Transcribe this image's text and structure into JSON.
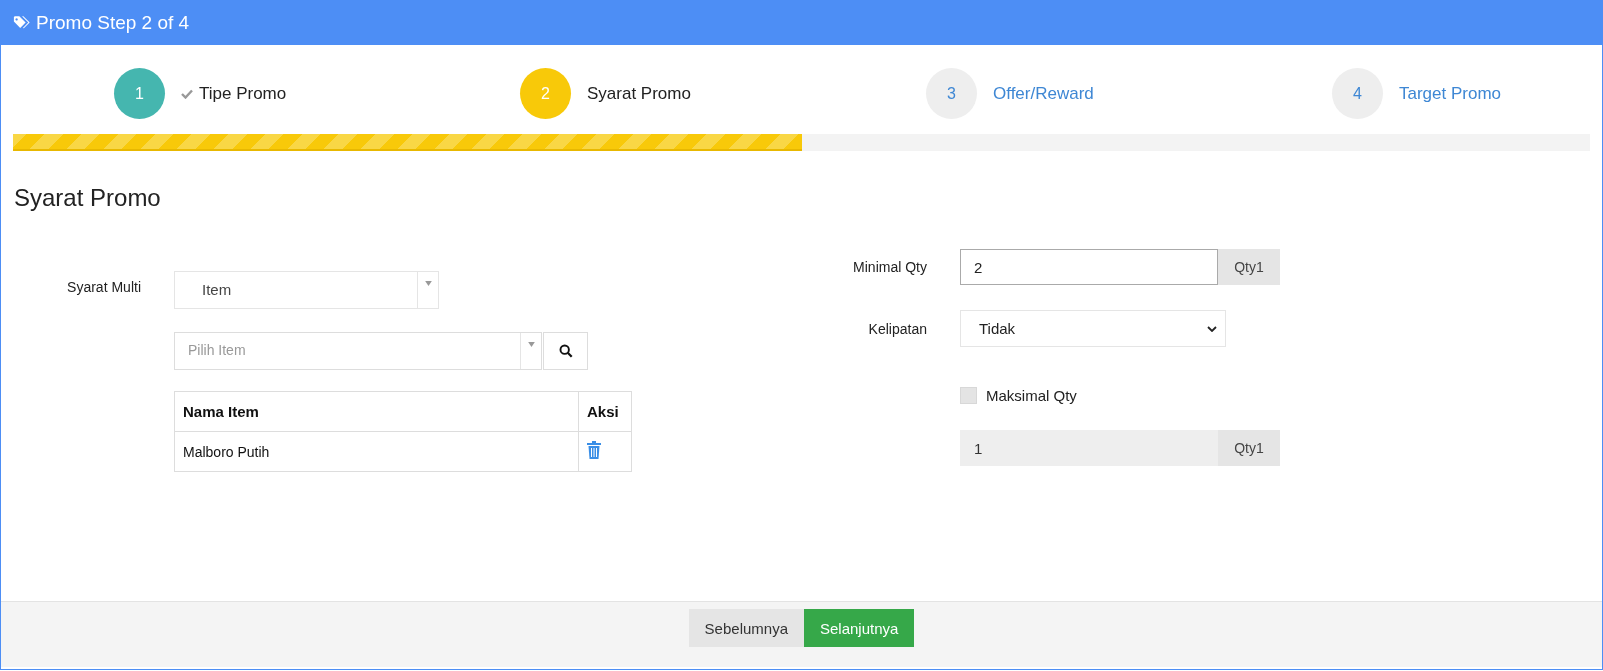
{
  "window": {
    "title": "Promo Step 2 of 4"
  },
  "steps": [
    {
      "number": "1",
      "label": "Tipe Promo",
      "completed": true,
      "selected": false
    },
    {
      "number": "2",
      "label": "Syarat Promo",
      "completed": false,
      "selected": true
    },
    {
      "number": "3",
      "label": "Offer/Reward",
      "completed": false,
      "selected": false
    },
    {
      "number": "4",
      "label": "Target Promo",
      "completed": false,
      "selected": false
    }
  ],
  "progress": {
    "level": 0.5
  },
  "section_title": "Syarat Promo",
  "left": {
    "syarat_multi": {
      "label": "Syarat Multi",
      "value": "Item"
    },
    "item_picker": {
      "placeholder": "Pilih Item"
    },
    "table": {
      "columns": [
        "Nama Item",
        "Aksi"
      ],
      "rows": [
        {
          "name": "Malboro Putih"
        }
      ]
    }
  },
  "right": {
    "minimal_qty": {
      "label": "Minimal Qty",
      "value": "2",
      "unit": "Qty1"
    },
    "kelipatan": {
      "label": "Kelipatan",
      "value": "Tidak"
    },
    "maksimal_qty": {
      "label": "Maksimal Qty",
      "checked": false,
      "value": "1",
      "unit": "Qty1",
      "disabled": true
    }
  },
  "buttons": [
    {
      "label": "Sebelumnya",
      "kind": "secondary"
    },
    {
      "label": "Selanjutnya",
      "kind": "primary"
    }
  ]
}
